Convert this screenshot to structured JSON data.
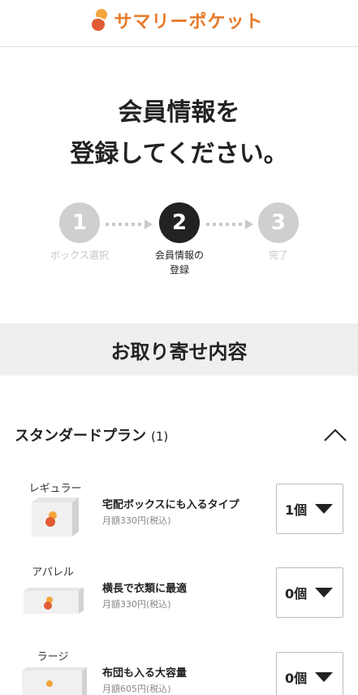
{
  "header": {
    "logo_text": "サマリーポケット",
    "logo_colors": [
      "#f3a53a",
      "#e15c34"
    ]
  },
  "page_title": {
    "line1": "会員情報を",
    "line2": "登録してください。"
  },
  "steps": [
    {
      "number": "1",
      "label": "ボックス選択",
      "state": "inactive"
    },
    {
      "number": "2",
      "label_line1": "会員情報の",
      "label_line2": "登録",
      "state": "active"
    },
    {
      "number": "3",
      "label": "完了",
      "state": "inactive"
    }
  ],
  "order_section": {
    "title": "お取り寄せ内容"
  },
  "plan": {
    "title": "スタンダードプラン",
    "count": "(1)",
    "expanded": true
  },
  "products": [
    {
      "size": "レギュラー",
      "name": "宅配ボックスにも入るタイプ",
      "price": "月額330円(税込)",
      "quantity": "1個"
    },
    {
      "size": "アパレル",
      "name": "横長で衣類に最適",
      "price": "月額330円(税込)",
      "quantity": "0個"
    },
    {
      "size": "ラージ",
      "name": "布団も入る大容量",
      "price": "月額605円(税込)",
      "quantity": "0個"
    }
  ]
}
